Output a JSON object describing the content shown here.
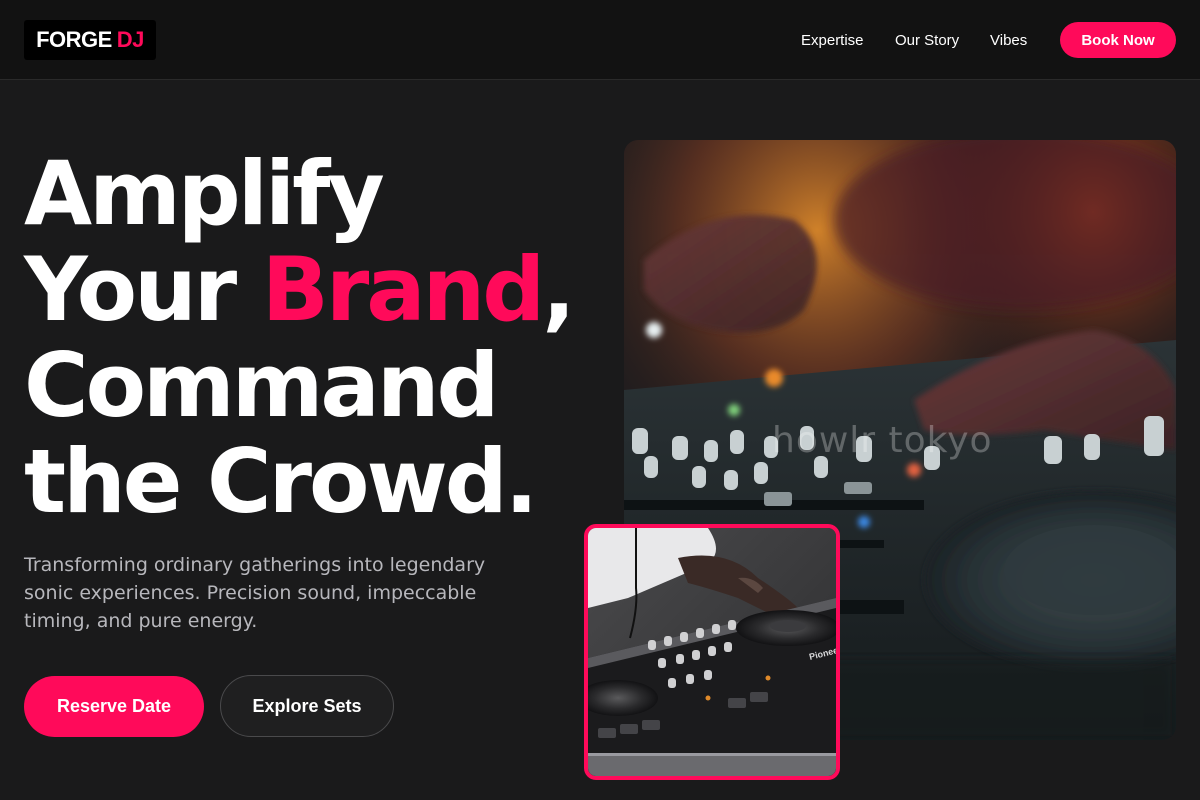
{
  "header": {
    "logo_primary": "FORGE",
    "logo_accent": "DJ",
    "nav": [
      {
        "label": "Expertise"
      },
      {
        "label": "Our Story"
      },
      {
        "label": "Vibes"
      }
    ],
    "cta_label": "Book Now"
  },
  "hero": {
    "headline_line1": "Amplify",
    "headline_line2_pre": "Your ",
    "headline_line2_accent": "Brand",
    "headline_line2_post": ",",
    "headline_line3": "Command",
    "headline_line4": "the Crowd.",
    "subtitle": "Transforming ordinary gatherings into legendary sonic experiences. Precision sound, impeccable timing, and pure energy.",
    "primary_button": "Reserve Date",
    "secondary_button": "Explore Sets"
  },
  "images": {
    "main_watermark": "howlr tokyo",
    "inset_brand": "Pioneer"
  },
  "colors": {
    "accent": "#ff0a5a",
    "background": "#1a1a1b",
    "header_bg": "#121212"
  }
}
